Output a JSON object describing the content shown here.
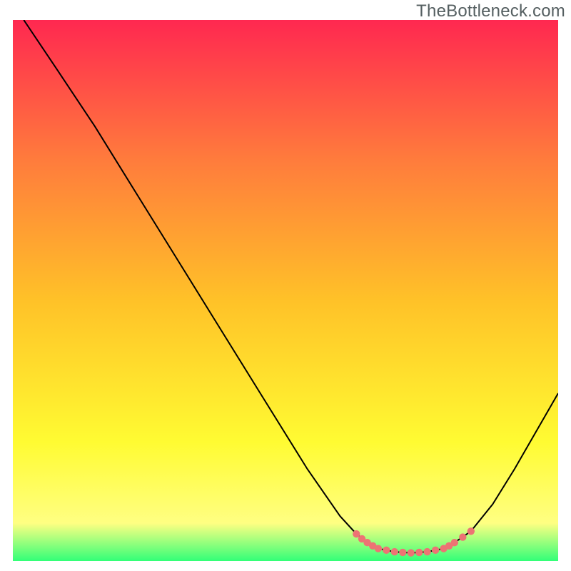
{
  "watermark": "TheBottleneck.com",
  "chart_data": {
    "type": "line",
    "title": "",
    "xlabel": "",
    "ylabel": "",
    "xlim": [
      0,
      100
    ],
    "ylim": [
      0,
      100
    ],
    "background_gradient": {
      "top": "#ff2850",
      "upper_mid": "#ff7c3c",
      "mid": "#ffc228",
      "lower_mid": "#fffb32",
      "near_bottom": "#ffff82",
      "bottom": "#32ff78"
    },
    "series": [
      {
        "name": "curve",
        "stroke": "#000000",
        "points": [
          {
            "x": 2.0,
            "y": 100.0
          },
          {
            "x": 8.0,
            "y": 91.0
          },
          {
            "x": 15.0,
            "y": 80.4
          },
          {
            "x": 22.0,
            "y": 69.0
          },
          {
            "x": 30.0,
            "y": 56.0
          },
          {
            "x": 38.0,
            "y": 43.0
          },
          {
            "x": 46.0,
            "y": 30.0
          },
          {
            "x": 54.0,
            "y": 17.0
          },
          {
            "x": 60.0,
            "y": 8.3
          },
          {
            "x": 63.0,
            "y": 5.0
          },
          {
            "x": 65.0,
            "y": 3.4
          },
          {
            "x": 67.0,
            "y": 2.3
          },
          {
            "x": 70.0,
            "y": 1.7
          },
          {
            "x": 73.0,
            "y": 1.5
          },
          {
            "x": 76.0,
            "y": 1.7
          },
          {
            "x": 79.0,
            "y": 2.3
          },
          {
            "x": 81.0,
            "y": 3.4
          },
          {
            "x": 84.0,
            "y": 5.5
          },
          {
            "x": 88.0,
            "y": 10.5
          },
          {
            "x": 92.0,
            "y": 17.0
          },
          {
            "x": 96.0,
            "y": 24.0
          },
          {
            "x": 100.0,
            "y": 31.0
          }
        ]
      },
      {
        "name": "optimal-range-marker",
        "stroke": "#ed7374",
        "dotted": true,
        "points": [
          {
            "x": 63.0,
            "y": 5.0
          },
          {
            "x": 64.0,
            "y": 4.1
          },
          {
            "x": 65.0,
            "y": 3.4
          },
          {
            "x": 66.0,
            "y": 2.8
          },
          {
            "x": 67.0,
            "y": 2.3
          },
          {
            "x": 68.5,
            "y": 2.0
          },
          {
            "x": 70.0,
            "y": 1.7
          },
          {
            "x": 71.5,
            "y": 1.6
          },
          {
            "x": 73.0,
            "y": 1.5
          },
          {
            "x": 74.5,
            "y": 1.6
          },
          {
            "x": 76.0,
            "y": 1.7
          },
          {
            "x": 77.5,
            "y": 2.0
          },
          {
            "x": 79.0,
            "y": 2.3
          },
          {
            "x": 80.0,
            "y": 2.8
          },
          {
            "x": 81.0,
            "y": 3.4
          },
          {
            "x": 82.5,
            "y": 4.4
          },
          {
            "x": 84.0,
            "y": 5.5
          }
        ]
      }
    ]
  }
}
